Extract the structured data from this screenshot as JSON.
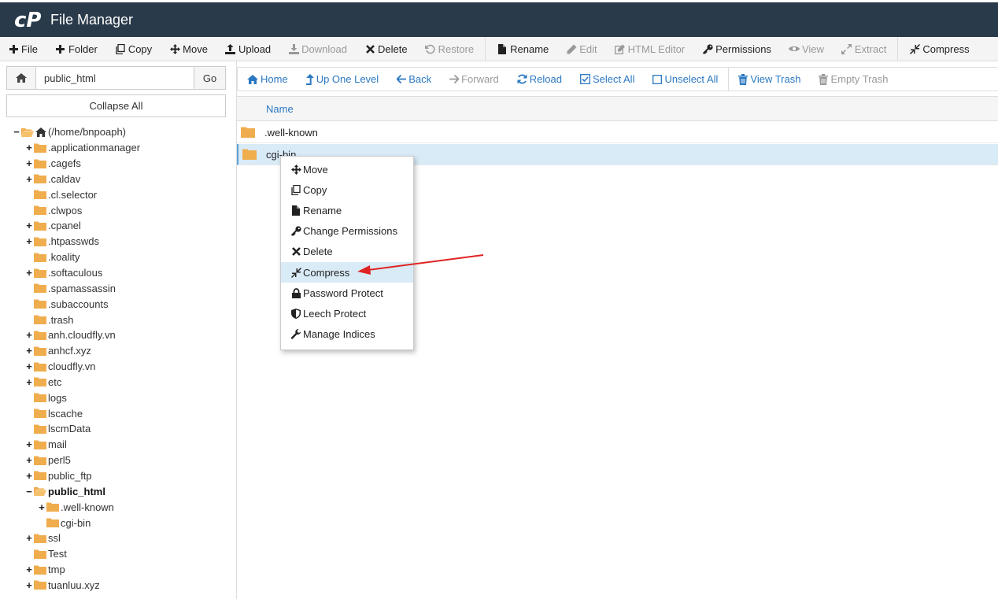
{
  "app": {
    "title": "File Manager",
    "logo_text": "cP"
  },
  "toolbar": {
    "items": [
      {
        "label": "File",
        "icon": "plus-icon",
        "enabled": true
      },
      {
        "label": "Folder",
        "icon": "plus-icon",
        "enabled": true
      },
      {
        "label": "Copy",
        "icon": "copy-icon",
        "enabled": true
      },
      {
        "label": "Move",
        "icon": "move-icon",
        "enabled": true
      },
      {
        "label": "Upload",
        "icon": "upload-icon",
        "enabled": true
      },
      {
        "label": "Download",
        "icon": "download-icon",
        "enabled": false
      },
      {
        "label": "Delete",
        "icon": "x-icon",
        "enabled": true
      },
      {
        "label": "Restore",
        "icon": "restore-icon",
        "enabled": false
      },
      {
        "label": "Rename",
        "icon": "file-icon",
        "enabled": true
      },
      {
        "label": "Edit",
        "icon": "pencil-icon",
        "enabled": false
      },
      {
        "label": "HTML Editor",
        "icon": "edit-square-icon",
        "enabled": false
      },
      {
        "label": "Permissions",
        "icon": "key-icon",
        "enabled": true
      },
      {
        "label": "View",
        "icon": "eye-icon",
        "enabled": false
      },
      {
        "label": "Extract",
        "icon": "expand-icon",
        "enabled": false
      },
      {
        "label": "Compress",
        "icon": "compress-icon",
        "enabled": true
      }
    ]
  },
  "sidebar": {
    "path_value": "public_html",
    "go_label": "Go",
    "collapse_label": "Collapse All",
    "tree": [
      {
        "label": "(/home/bnpoaph)",
        "toggle": "−",
        "level": 0,
        "open": true,
        "home": true
      },
      {
        "label": ".applicationmanager",
        "toggle": "+",
        "level": 1
      },
      {
        "label": ".cagefs",
        "toggle": "+",
        "level": 1
      },
      {
        "label": ".caldav",
        "toggle": "+",
        "level": 1
      },
      {
        "label": ".cl.selector",
        "toggle": "",
        "level": 1
      },
      {
        "label": ".clwpos",
        "toggle": "",
        "level": 1
      },
      {
        "label": ".cpanel",
        "toggle": "+",
        "level": 1
      },
      {
        "label": ".htpasswds",
        "toggle": "+",
        "level": 1
      },
      {
        "label": ".koality",
        "toggle": "",
        "level": 1
      },
      {
        "label": ".softaculous",
        "toggle": "+",
        "level": 1
      },
      {
        "label": ".spamassassin",
        "toggle": "",
        "level": 1
      },
      {
        "label": ".subaccounts",
        "toggle": "",
        "level": 1
      },
      {
        "label": ".trash",
        "toggle": "",
        "level": 1
      },
      {
        "label": "anh.cloudfly.vn",
        "toggle": "+",
        "level": 1
      },
      {
        "label": "anhcf.xyz",
        "toggle": "+",
        "level": 1
      },
      {
        "label": "cloudfly.vn",
        "toggle": "+",
        "level": 1
      },
      {
        "label": "etc",
        "toggle": "+",
        "level": 1
      },
      {
        "label": "logs",
        "toggle": "",
        "level": 1
      },
      {
        "label": "lscache",
        "toggle": "",
        "level": 1
      },
      {
        "label": "lscmData",
        "toggle": "",
        "level": 1
      },
      {
        "label": "mail",
        "toggle": "+",
        "level": 1
      },
      {
        "label": "perl5",
        "toggle": "+",
        "level": 1
      },
      {
        "label": "public_ftp",
        "toggle": "+",
        "level": 1
      },
      {
        "label": "public_html",
        "toggle": "−",
        "level": 1,
        "open": true,
        "bold": true
      },
      {
        "label": ".well-known",
        "toggle": "+",
        "level": 2
      },
      {
        "label": "cgi-bin",
        "toggle": "",
        "level": 2
      },
      {
        "label": "ssl",
        "toggle": "+",
        "level": 1
      },
      {
        "label": "Test",
        "toggle": "",
        "level": 1
      },
      {
        "label": "tmp",
        "toggle": "+",
        "level": 1
      },
      {
        "label": "tuanluu.xyz",
        "toggle": "+",
        "level": 1
      }
    ]
  },
  "actionbar": {
    "items": [
      {
        "label": "Home",
        "icon": "home-icon",
        "enabled": true
      },
      {
        "label": "Up One Level",
        "icon": "level-up-icon",
        "enabled": true
      },
      {
        "label": "Back",
        "icon": "arrow-left-icon",
        "enabled": true
      },
      {
        "label": "Forward",
        "icon": "arrow-right-icon",
        "enabled": false
      },
      {
        "label": "Reload",
        "icon": "reload-icon",
        "enabled": true
      },
      {
        "label": "Select All",
        "icon": "check-square-icon",
        "enabled": true
      },
      {
        "label": "Unselect All",
        "icon": "square-icon",
        "enabled": true
      },
      {
        "label": "View Trash",
        "icon": "trash-icon",
        "enabled": true
      },
      {
        "label": "Empty Trash",
        "icon": "trash-icon",
        "enabled": false
      }
    ]
  },
  "file_list": {
    "column_name": "Name",
    "rows": [
      {
        "name": ".well-known",
        "selected": false
      },
      {
        "name": "cgi-bin",
        "selected": true
      }
    ]
  },
  "context_menu": {
    "items": [
      {
        "label": "Move",
        "icon": "move-icon"
      },
      {
        "label": "Copy",
        "icon": "copy-icon"
      },
      {
        "label": "Rename",
        "icon": "file-icon"
      },
      {
        "label": "Change Permissions",
        "icon": "key-icon"
      },
      {
        "label": "Delete",
        "icon": "x-icon"
      },
      {
        "label": "Compress",
        "icon": "compress-icon",
        "highlighted": true
      },
      {
        "label": "Password Protect",
        "icon": "lock-icon"
      },
      {
        "label": "Leech Protect",
        "icon": "shield-icon"
      },
      {
        "label": "Manage Indices",
        "icon": "wrench-icon"
      }
    ]
  },
  "colors": {
    "header_bg": "#293a4a",
    "link": "#2a78c2",
    "folder": "#f0ad4e",
    "selected_row": "#d9ebf7",
    "annotation_arrow": "#e02424"
  }
}
